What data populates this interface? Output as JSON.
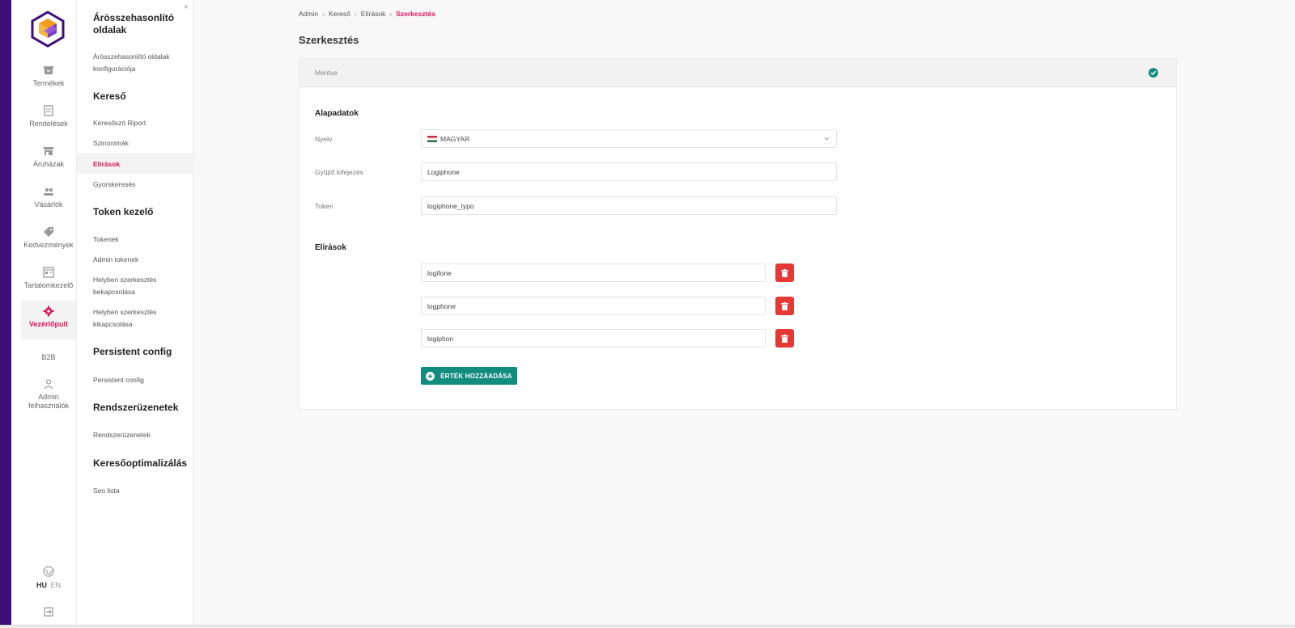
{
  "colors": {
    "accent": "#e2145d",
    "brand": "#3d0e7a",
    "primary": "#128c7e",
    "danger": "#e53935"
  },
  "rail": {
    "items": [
      {
        "label": "Termékek",
        "icon": "archive-icon"
      },
      {
        "label": "Rendelések",
        "icon": "receipt-icon"
      },
      {
        "label": "Áruházak",
        "icon": "store-icon"
      },
      {
        "label": "Vásárlók",
        "icon": "users-icon"
      },
      {
        "label": "Kedvezmények",
        "icon": "tag-icon"
      },
      {
        "label": "Tartalomkezelő",
        "icon": "content-icon"
      },
      {
        "label": "Vezérlőpult",
        "icon": "gear-icon",
        "active": true
      },
      {
        "label": "B2B",
        "icon": ""
      },
      {
        "label": "Admin felhasználók",
        "icon": "user-icon"
      }
    ],
    "lang": {
      "hu": "HU",
      "en": "EN"
    }
  },
  "submenu": {
    "close": "×",
    "groups": [
      {
        "title": "Árösszehasonlító oldalak",
        "links": [
          "Árösszehasonlító oldalak konfigurációja"
        ]
      },
      {
        "title": "Kereső",
        "links": [
          "Keresőszó Riport",
          "Szinonimák",
          "Elírások",
          "Gyorskeresés"
        ]
      },
      {
        "title": "Token kezelő",
        "links": [
          "Tokenek",
          "Admin tokenek",
          "Helyben szerkesztés bekapcsolása",
          "Helyben szerkesztés kikapcsolása"
        ]
      },
      {
        "title": "Persistent config",
        "links": [
          "Persistent config"
        ]
      },
      {
        "title": "Rendszerüzenetek",
        "links": [
          "Rendszerüzenetek"
        ]
      },
      {
        "title": "Keresőoptimalizálás",
        "links": [
          "Seo lista"
        ]
      }
    ],
    "active": "Elírások"
  },
  "breadcrumb": [
    "Admin",
    "Kereső",
    "Elírások",
    "Szerkesztés"
  ],
  "page_title": "Szerkesztés",
  "saved": {
    "text": "Mentve"
  },
  "basic": {
    "title": "Alapadatok",
    "language_label": "Nyelv",
    "language_value": "MAGYAR",
    "phrase_label": "Gyűjtő kifejezés",
    "phrase_value": "Logiphone",
    "token_label": "Token",
    "token_value": "logiphone_typo"
  },
  "typos": {
    "title": "Elírások",
    "values": [
      "logifone",
      "logphone",
      "logiphon"
    ],
    "add_label": "ÉRTÉK HOZZÁADÁSA"
  }
}
